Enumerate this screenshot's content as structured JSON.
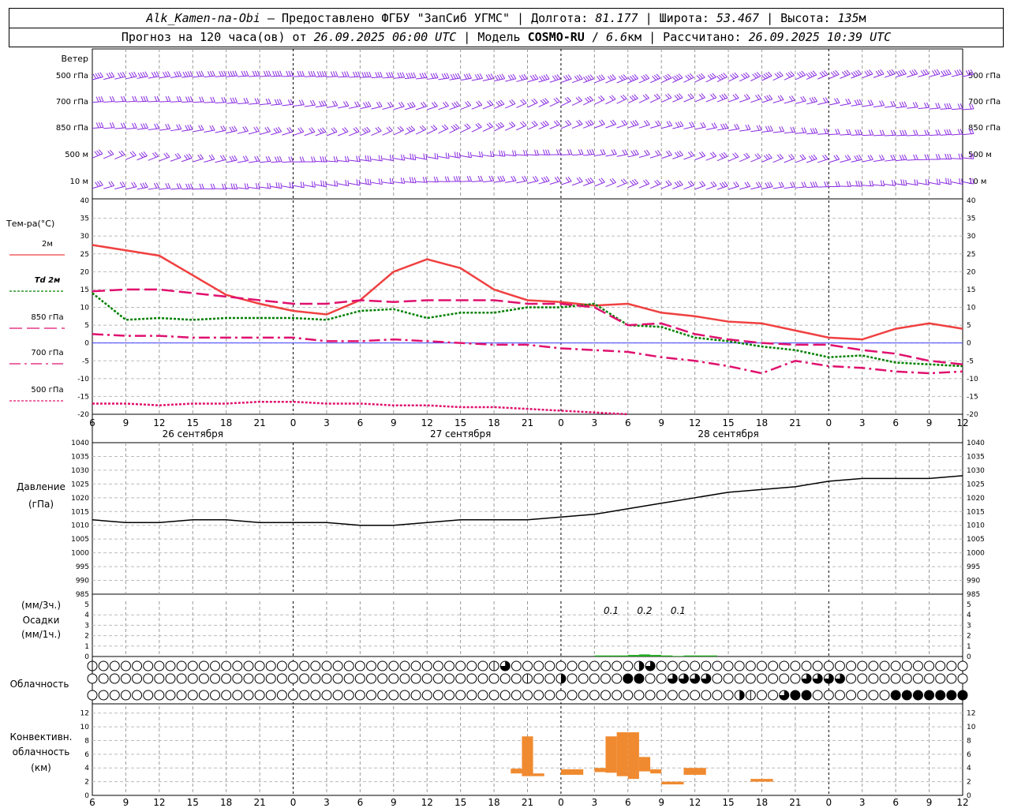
{
  "header": {
    "station": "Alk_Kamen-na-Obi",
    "provider": " – Предоставлено ФГБУ \"ЗапСиб УГМС\" | Долгота: ",
    "longitude": "81.177",
    "lat_label": " | Широта: ",
    "latitude": "53.467",
    "alt_label": " | Высота: ",
    "altitude": "135",
    "alt_unit": "м",
    "forecast_prefix": "Прогноз на 120 часа(ов) от ",
    "forecast_start": "26.09.2025 06:00 UTC",
    "model_label": "  | Модель ",
    "model_name": "COSMO-RU",
    "model_sep": " / ",
    "model_res": "6.6",
    "model_res_unit": "км",
    "calc_label": " | Рассчитано: ",
    "calc_time": "26.09.2025 10:39 UTC"
  },
  "colors": {
    "t2m": "#f04040",
    "td2m": "#008000",
    "t850": "#e0106e",
    "t700": "#e0106e",
    "t500": "#e0106e",
    "wind": "#8a2be2",
    "pressure": "#000000",
    "precip": "#22aa22",
    "conv": "#f08a30",
    "zero_line": "#4040ff"
  },
  "time_axis": {
    "hour_labels": [
      "6",
      "9",
      "12",
      "15",
      "18",
      "21",
      "0",
      "3",
      "6",
      "9",
      "12",
      "15",
      "18",
      "21",
      "0",
      "3",
      "6",
      "9",
      "12",
      "15",
      "18",
      "21",
      "0",
      "3",
      "6",
      "9",
      "12"
    ],
    "date_labels": [
      {
        "label": "26 сентября",
        "hour": 9
      },
      {
        "label": "27 сентября",
        "hour": 33
      },
      {
        "label": "28 сентября",
        "hour": 57
      }
    ],
    "day_boundaries_hours": [
      18,
      42,
      66,
      90
    ],
    "x_range_hours": [
      0,
      78
    ]
  },
  "wind_panel": {
    "title": "Ветер",
    "levels": [
      "500 гПа",
      "700 гПа",
      "850 гПа",
      "500 м",
      "10  м"
    ],
    "type": "barbs"
  },
  "chart_data": [
    {
      "type": "line",
      "name": "temperature",
      "title": "Тем-ра(°C)",
      "x_units": "hours since 26.09 06 UTC",
      "x": [
        0,
        3,
        6,
        9,
        12,
        15,
        18,
        21,
        24,
        27,
        30,
        33,
        36,
        39,
        42,
        45,
        48,
        51,
        54,
        57,
        60,
        63,
        66,
        69,
        72,
        75,
        78
      ],
      "ylim": [
        -20,
        40
      ],
      "yticks": [
        -20,
        -15,
        -10,
        -5,
        0,
        5,
        10,
        15,
        20,
        25,
        30,
        35,
        40
      ],
      "series": [
        {
          "name": "2м",
          "style": "solid",
          "values": [
            27.5,
            26,
            24.5,
            19,
            13.5,
            11,
            9,
            8,
            12,
            20,
            23.5,
            21,
            15,
            12,
            11.5,
            10.5,
            11,
            8.5,
            7.5,
            6,
            5.5,
            3.5,
            1.5,
            1,
            4,
            5.5,
            4
          ]
        },
        {
          "name": "Td 2м",
          "style": "dotted",
          "values": [
            14,
            6.5,
            7,
            6.5,
            7,
            7,
            7,
            6.5,
            9,
            9.5,
            7,
            8.5,
            8.5,
            10,
            10,
            11,
            5,
            4.5,
            1.5,
            0.5,
            -1,
            -2,
            -4,
            -3.5,
            -5.5,
            -6,
            -6.5
          ]
        },
        {
          "name": "850 гПа",
          "style": "long-dash",
          "values": [
            14.5,
            15,
            15,
            14,
            13,
            12,
            11,
            11,
            12,
            11.5,
            12,
            12,
            12,
            11,
            11,
            10,
            5,
            5.5,
            2.5,
            1,
            0,
            -0.5,
            -0.5,
            -2,
            -3,
            -5,
            -6
          ]
        },
        {
          "name": "700 гПа",
          "style": "dash-dot",
          "values": [
            2.5,
            2,
            2,
            1.5,
            1.5,
            1.5,
            1.5,
            0.5,
            0.5,
            1,
            0.5,
            0,
            -0.5,
            -0.5,
            -1.5,
            -2,
            -2.5,
            -4,
            -5,
            -6.5,
            -8.5,
            -5,
            -6.5,
            -7,
            -8,
            -8.5,
            -8
          ]
        },
        {
          "name": "500 гПа",
          "style": "fine-dash",
          "values": [
            -17,
            -17,
            -17.5,
            -17,
            -17,
            -16.5,
            -16.5,
            -17,
            -17,
            -17.5,
            -17.5,
            -18,
            -18,
            -18.5,
            -19,
            -19.5,
            -20
          ]
        }
      ]
    },
    {
      "type": "line",
      "name": "pressure",
      "title": "Давление",
      "unit": "(гПа)",
      "x": [
        0,
        3,
        6,
        9,
        12,
        15,
        18,
        21,
        24,
        27,
        30,
        33,
        36,
        39,
        42,
        45,
        48,
        51,
        54,
        57,
        60,
        63,
        66,
        69,
        72,
        75,
        78
      ],
      "ylim": [
        985,
        1040
      ],
      "yticks": [
        985,
        990,
        995,
        1000,
        1005,
        1010,
        1015,
        1020,
        1025,
        1030,
        1035,
        1040
      ],
      "values": [
        1012,
        1011,
        1011,
        1012,
        1012,
        1011,
        1011,
        1011,
        1010,
        1010,
        1011,
        1012,
        1012,
        1012,
        1013,
        1014,
        1016,
        1018,
        1020,
        1022,
        1023,
        1024,
        1026,
        1027,
        1027,
        1027,
        1028
      ]
    },
    {
      "type": "bar",
      "name": "precipitation",
      "title": "Осадки",
      "unit_top": "(мм/3ч.)",
      "unit_bottom": "(мм/1ч.)",
      "ylim": [
        0,
        5
      ],
      "yticks": [
        0,
        1,
        2,
        3,
        4,
        5
      ],
      "labels": [
        {
          "text": "0.1",
          "hour": 46.5
        },
        {
          "text": "0.2",
          "hour": 49.5
        },
        {
          "text": "0.1",
          "hour": 52.5
        }
      ],
      "x": [
        45,
        46,
        47,
        48,
        49,
        50,
        51,
        52,
        53,
        54,
        55
      ],
      "values": [
        0.1,
        0.1,
        0.1,
        0.15,
        0.2,
        0.15,
        0.1,
        0.05,
        0.1,
        0.1,
        0.1
      ]
    },
    {
      "type": "bar",
      "name": "convective_cloud",
      "title": "Конвективн. облачность",
      "unit": "(км)",
      "ylim": [
        0,
        13
      ],
      "yticks": [
        0,
        2,
        4,
        6,
        8,
        10,
        12
      ],
      "bars": [
        {
          "x0": 37.5,
          "x1": 38.5,
          "base": 3.2,
          "top": 3.9
        },
        {
          "x0": 38.5,
          "x1": 39.5,
          "base": 2.8,
          "top": 8.6
        },
        {
          "x0": 39.5,
          "x1": 40.5,
          "base": 2.8,
          "top": 3.2
        },
        {
          "x0": 42,
          "x1": 44,
          "base": 3.0,
          "top": 3.8
        },
        {
          "x0": 45,
          "x1": 46,
          "base": 3.4,
          "top": 4.0
        },
        {
          "x0": 46,
          "x1": 47,
          "base": 3.3,
          "top": 8.6
        },
        {
          "x0": 47,
          "x1": 48,
          "base": 2.8,
          "top": 9.2
        },
        {
          "x0": 48,
          "x1": 49,
          "base": 2.4,
          "top": 9.2
        },
        {
          "x0": 49,
          "x1": 50,
          "base": 3.5,
          "top": 5.6
        },
        {
          "x0": 50,
          "x1": 51,
          "base": 3.2,
          "top": 3.8
        },
        {
          "x0": 51,
          "x1": 53,
          "base": 1.6,
          "top": 2.0
        },
        {
          "x0": 53,
          "x1": 55,
          "base": 3.0,
          "top": 4.0
        },
        {
          "x0": 59,
          "x1": 61,
          "base": 2.0,
          "top": 2.4
        }
      ]
    }
  ],
  "cloud_panel": {
    "title": "Облачность",
    "rows": [
      "1000000000000000000000000000000000001300000000000230000000000000000000000000000000000000000000000",
      "0000000000000000000000000000000000000001002000004400333300000000333300000000000000000000",
      "0000000000000000000000000000000000000000000000000000000000210034400000004444444440333342222222222"
    ]
  },
  "cloud_symbols": {
    "0": "clear",
    "1": "quarter",
    "2": "half",
    "3": "three-quarter",
    "4": "overcast"
  }
}
